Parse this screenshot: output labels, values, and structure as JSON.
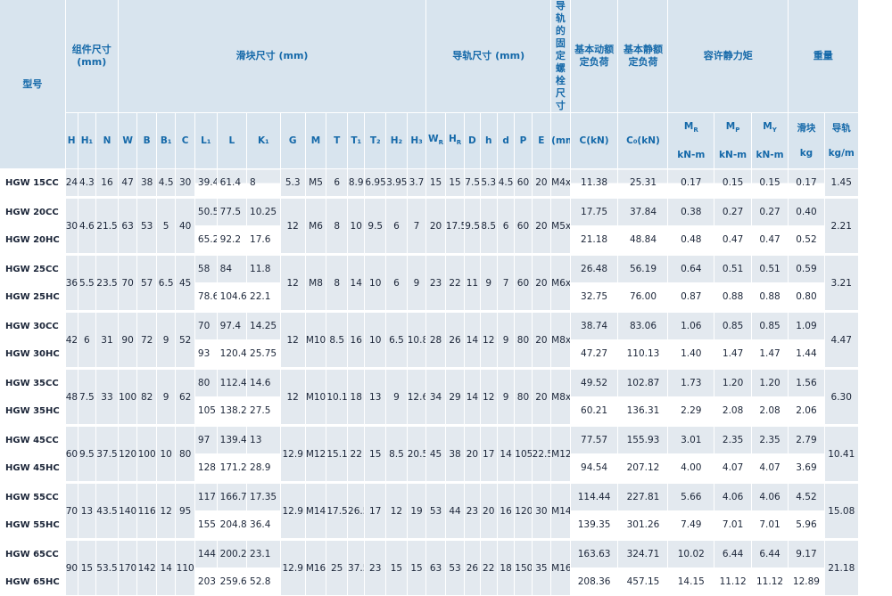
{
  "headers": {
    "model": "型号",
    "assembly": "组件尺寸\n(mm)",
    "block": "滑块尺寸 (mm)",
    "rail": "导轨尺寸 (mm)",
    "bolt": "导轨的固定螺栓尺寸",
    "dyn": "基本动额定负荷",
    "stat": "基本静额定负荷",
    "moment": "容许静力矩",
    "weight": "重量",
    "cols": [
      "H",
      "H₁",
      "N",
      "W",
      "B",
      "B₁",
      "C",
      "L₁",
      "L",
      "K₁",
      "G",
      "M",
      "T",
      "T₁",
      "T₂",
      "H₂",
      "H₃",
      "W_R",
      "H_R",
      "D",
      "h",
      "d",
      "P",
      "E"
    ],
    "bolt_unit": "(mm)",
    "dyn_unit": "C(kN)",
    "stat_unit": "C₀(kN)",
    "mr": "M_R",
    "mp": "M_P",
    "my": "M_Y",
    "moment_unit": "kN-m",
    "block_w": "滑块",
    "block_w_unit": "kg",
    "rail_w": "导轨",
    "rail_w_unit": "kg/m"
  },
  "groups": [
    {
      "H": "24",
      "H1": "4.3",
      "N": "16",
      "W": "47",
      "B": "38",
      "B1": "4.5",
      "C": "30",
      "G": "5.3",
      "M": "M5",
      "T": "6",
      "T1": "8.9",
      "T2": "6.95",
      "H2": "3.95",
      "H3": "3.7",
      "WR": "15",
      "HR": "15",
      "D": "7.5",
      "h": "5.3",
      "d": "4.5",
      "P": "60",
      "E": "20",
      "bolt": "M4x16",
      "rail_w": "1.45",
      "rows": [
        {
          "model": "HGW 15CC",
          "L1": "39.4",
          "L": "61.4",
          "K1": "8",
          "C": "11.38",
          "C0": "25.31",
          "MR": "0.17",
          "MP": "0.15",
          "MY": "0.15",
          "bw": "0.17"
        }
      ]
    },
    {
      "H": "30",
      "H1": "4.6",
      "N": "21.5",
      "W": "63",
      "B": "53",
      "B1": "5",
      "C": "40",
      "G": "12",
      "M": "M6",
      "T": "8",
      "T1": "10",
      "T2": "9.5",
      "H2": "6",
      "H3": "7",
      "WR": "20",
      "HR": "17.5",
      "D": "9.5",
      "h": "8.5",
      "d": "6",
      "P": "60",
      "E": "20",
      "bolt": "M5x16",
      "rail_w": "2.21",
      "rows": [
        {
          "model": "HGW 20CC",
          "L1": "50.5",
          "L": "77.5",
          "K1": "10.25",
          "C": "17.75",
          "C0": "37.84",
          "MR": "0.38",
          "MP": "0.27",
          "MY": "0.27",
          "bw": "0.40"
        },
        {
          "model": "HGW 20HC",
          "L1": "65.2",
          "L": "92.2",
          "K1": "17.6",
          "C": "21.18",
          "C0": "48.84",
          "MR": "0.48",
          "MP": "0.47",
          "MY": "0.47",
          "bw": "0.52"
        }
      ]
    },
    {
      "H": "36",
      "H1": "5.5",
      "N": "23.5",
      "W": "70",
      "B": "57",
      "B1": "6.5",
      "C": "45",
      "G": "12",
      "M": "M8",
      "T": "8",
      "T1": "14",
      "T2": "10",
      "H2": "6",
      "H3": "9",
      "WR": "23",
      "HR": "22",
      "D": "11",
      "h": "9",
      "d": "7",
      "P": "60",
      "E": "20",
      "bolt": "M6x20",
      "rail_w": "3.21",
      "rows": [
        {
          "model": "HGW 25CC",
          "L1": "58",
          "L": "84",
          "K1": "11.8",
          "C": "26.48",
          "C0": "56.19",
          "MR": "0.64",
          "MP": "0.51",
          "MY": "0.51",
          "bw": "0.59"
        },
        {
          "model": "HGW 25HC",
          "L1": "78.6",
          "L": "104.6",
          "K1": "22.1",
          "C": "32.75",
          "C0": "76.00",
          "MR": "0.87",
          "MP": "0.88",
          "MY": "0.88",
          "bw": "0.80"
        }
      ]
    },
    {
      "H": "42",
      "H1": "6",
      "N": "31",
      "W": "90",
      "B": "72",
      "B1": "9",
      "C": "52",
      "G": "12",
      "M": "M10",
      "T": "8.5",
      "T1": "16",
      "T2": "10",
      "H2": "6.5",
      "H3": "10.8",
      "WR": "28",
      "HR": "26",
      "D": "14",
      "h": "12",
      "d": "9",
      "P": "80",
      "E": "20",
      "bolt": "M8x25",
      "rail_w": "4.47",
      "rows": [
        {
          "model": "HGW 30CC",
          "L1": "70",
          "L": "97.4",
          "K1": "14.25",
          "C": "38.74",
          "C0": "83.06",
          "MR": "1.06",
          "MP": "0.85",
          "MY": "0.85",
          "bw": "1.09"
        },
        {
          "model": "HGW 30HC",
          "L1": "93",
          "L": "120.4",
          "K1": "25.75",
          "C": "47.27",
          "C0": "110.13",
          "MR": "1.40",
          "MP": "1.47",
          "MY": "1.47",
          "bw": "1.44"
        }
      ]
    },
    {
      "H": "48",
      "H1": "7.5",
      "N": "33",
      "W": "100",
      "B": "82",
      "B1": "9",
      "C": "62",
      "G": "12",
      "M": "M10",
      "T": "10.1",
      "T1": "18",
      "T2": "13",
      "H2": "9",
      "H3": "12.6",
      "WR": "34",
      "HR": "29",
      "D": "14",
      "h": "12",
      "d": "9",
      "P": "80",
      "E": "20",
      "bolt": "M8x25",
      "rail_w": "6.30",
      "rows": [
        {
          "model": "HGW 35CC",
          "L1": "80",
          "L": "112.4",
          "K1": "14.6",
          "C": "49.52",
          "C0": "102.87",
          "MR": "1.73",
          "MP": "1.20",
          "MY": "1.20",
          "bw": "1.56"
        },
        {
          "model": "HGW 35HC",
          "L1": "105.8",
          "L": "138.2",
          "K1": "27.5",
          "C": "60.21",
          "C0": "136.31",
          "MR": "2.29",
          "MP": "2.08",
          "MY": "2.08",
          "bw": "2.06"
        }
      ]
    },
    {
      "H": "60",
      "H1": "9.5",
      "N": "37.5",
      "W": "120",
      "B": "100",
      "B1": "10",
      "C": "80",
      "G": "12.9",
      "M": "M12",
      "T": "15.1",
      "T1": "22",
      "T2": "15",
      "H2": "8.5",
      "H3": "20.5",
      "WR": "45",
      "HR": "38",
      "D": "20",
      "h": "17",
      "d": "14",
      "P": "105",
      "E": "22.5",
      "bolt": "M12x35",
      "rail_w": "10.41",
      "rows": [
        {
          "model": "HGW 45CC",
          "L1": "97",
          "L": "139.4",
          "K1": "13",
          "C": "77.57",
          "C0": "155.93",
          "MR": "3.01",
          "MP": "2.35",
          "MY": "2.35",
          "bw": "2.79"
        },
        {
          "model": "HGW 45HC",
          "L1": "128.8",
          "L": "171.2",
          "K1": "28.9",
          "C": "94.54",
          "C0": "207.12",
          "MR": "4.00",
          "MP": "4.07",
          "MY": "4.07",
          "bw": "3.69"
        }
      ]
    },
    {
      "H": "70",
      "H1": "13",
      "N": "43.5",
      "W": "140",
      "B": "116",
      "B1": "12",
      "C": "95",
      "G": "12.9",
      "M": "M14",
      "T": "17.5",
      "T1": "26.5",
      "T2": "17",
      "H2": "12",
      "H3": "19",
      "WR": "53",
      "HR": "44",
      "D": "23",
      "h": "20",
      "d": "16",
      "P": "120",
      "E": "30",
      "bolt": "M14x45",
      "rail_w": "15.08",
      "rows": [
        {
          "model": "HGW 55CC",
          "L1": "117.7",
          "L": "166.7",
          "K1": "17.35",
          "C": "114.44",
          "C0": "227.81",
          "MR": "5.66",
          "MP": "4.06",
          "MY": "4.06",
          "bw": "4.52"
        },
        {
          "model": "HGW 55HC",
          "L1": "155.8",
          "L": "204.8",
          "K1": "36.4",
          "C": "139.35",
          "C0": "301.26",
          "MR": "7.49",
          "MP": "7.01",
          "MY": "7.01",
          "bw": "5.96"
        }
      ]
    },
    {
      "H": "90",
      "H1": "15",
      "N": "53.5",
      "W": "170",
      "B": "142",
      "B1": "14",
      "C": "110",
      "G": "12.9",
      "M": "M16",
      "T": "25",
      "T1": "37.5",
      "T2": "23",
      "H2": "15",
      "H3": "15",
      "WR": "63",
      "HR": "53",
      "D": "26",
      "h": "22",
      "d": "18",
      "P": "150",
      "E": "35",
      "bolt": "M16x50",
      "rail_w": "21.18",
      "rows": [
        {
          "model": "HGW 65CC",
          "L1": "144.2",
          "L": "200.2",
          "K1": "23.1",
          "C": "163.63",
          "C0": "324.71",
          "MR": "10.02",
          "MP": "6.44",
          "MY": "6.44",
          "bw": "9.17"
        },
        {
          "model": "HGW 65HC",
          "L1": "203.6",
          "L": "259.6",
          "K1": "52.8",
          "C": "208.36",
          "C0": "457.15",
          "MR": "14.15",
          "MP": "11.12",
          "MY": "11.12",
          "bw": "12.89"
        }
      ]
    }
  ]
}
